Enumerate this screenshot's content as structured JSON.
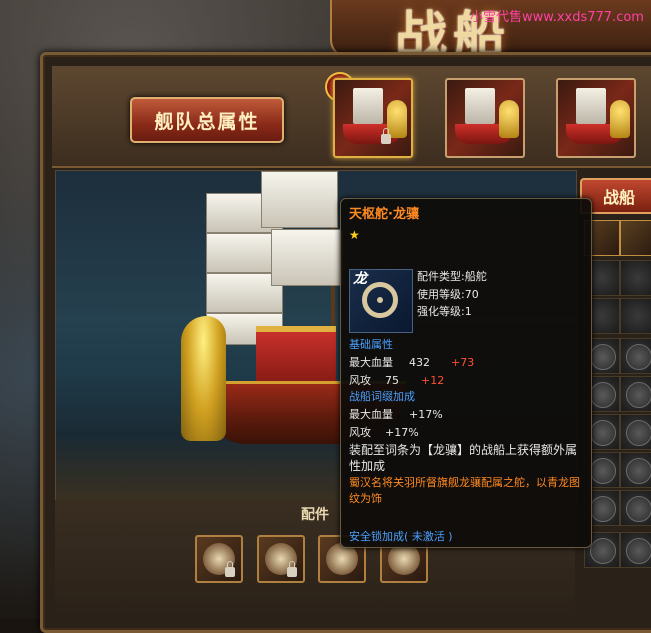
{
  "header": {
    "title": "战船",
    "watermark": "小雪代售www.xxds777.com"
  },
  "fleet_button": {
    "label": "舰队总属性"
  },
  "king_badge": "王",
  "side_panel": {
    "tab_label": "战船"
  },
  "parts": {
    "label": "配件"
  },
  "tooltip": {
    "name": "天枢舵·龙骧",
    "stars": "★",
    "icon_glyph": "龙",
    "part_type": "配件类型:船舵",
    "use_level": "使用等级:70",
    "enhance_level": "强化等级:1",
    "base_header": "基础属性",
    "hp_label": "最大血量",
    "hp_value": "432",
    "hp_bonus": "+73",
    "atk_label": "风攻",
    "atk_value": "75",
    "atk_bonus": "+12",
    "affix_header": "战船词缀加成",
    "affix_hp": "最大血量",
    "affix_hp_value": "+17%",
    "affix_atk": "风攻",
    "affix_atk_value": "+17%",
    "set_desc": "装配至词条为【龙骧】的战船上获得额外属性加成",
    "lore": "蜀汉名将关羽所督旗舰龙骧配属之舵，以青龙图纹为饰",
    "lock_bonus": "安全锁加成( 未激活 )"
  },
  "colors": {
    "name_orange": "#ff8a20",
    "header_blue": "#4aa0ff",
    "bonus_red": "#ff5030",
    "star_gold": "#ffd020"
  }
}
